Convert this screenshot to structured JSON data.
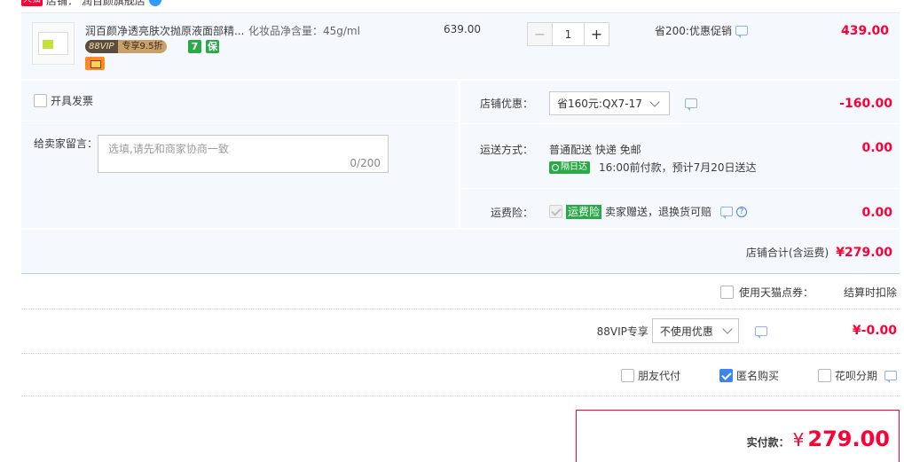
{
  "shop": {
    "badge": "天猫",
    "label": "店铺：",
    "name": "润百颜旗舰店"
  },
  "item": {
    "title": "润百颜净透亮肤次抛原液面部精...",
    "spec": "化妆品净含量：45g/ml",
    "vip_tag_left": "88VIP",
    "vip_tag_right": "专享9.5折",
    "icon_7": "7",
    "icon_bao": "保",
    "original_price": "639.00",
    "quantity": "1",
    "minus": "−",
    "plus": "+",
    "promotion": "省200:优惠促销",
    "price": "439.00"
  },
  "options": {
    "invoice_label": "开具发票",
    "message_label": "给卖家留言：",
    "message_placeholder": "选填,请先和商家协商一致",
    "message_count": "0/200",
    "shop_discount_label": "店铺优惠：",
    "shop_discount_selected": "省160元:QX7-17",
    "shop_discount_amount": "-160.00",
    "shipping_label": "运送方式：",
    "shipping_method": "普通配送 快递 免邮",
    "shipping_badge": "隔日达",
    "shipping_note": "16:00前付款，预计7月20日送达",
    "shipping_amount": "0.00",
    "insurance_label": "运费险：",
    "insurance_tag": "运费险",
    "insurance_text": "卖家赠送，退换货可赔",
    "insurance_amount": "0.00"
  },
  "shop_total": {
    "label": "店铺合计(含运费)",
    "amount": "¥279.00"
  },
  "points": {
    "label": "使用天猫点券：",
    "note": "结算时扣除"
  },
  "vip88": {
    "label": "88VIP专享",
    "selected": "不使用优惠",
    "amount": "¥-0.00"
  },
  "extras": {
    "friend_pay": "朋友代付",
    "anonymous": "匿名购买",
    "huabei": "花呗分期"
  },
  "pay": {
    "label": "实付款：",
    "yen": "¥",
    "amount": "279.00"
  },
  "colors": {
    "accent_red": "#ff0036",
    "panel_bg": "#f5f8fd",
    "checkbox_blue": "#3d84ef"
  }
}
